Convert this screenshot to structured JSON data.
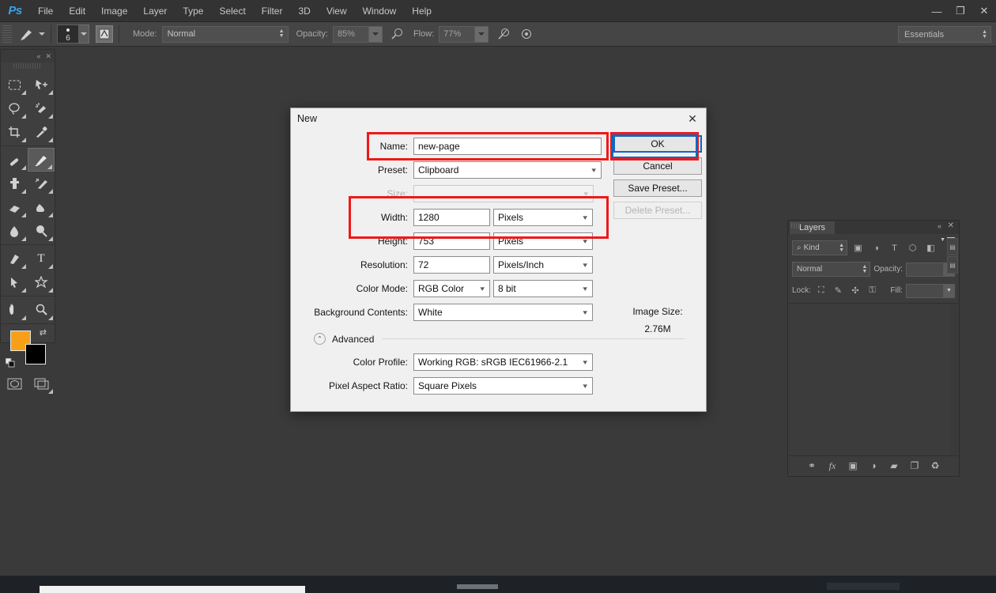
{
  "app": {
    "logo": "Ps",
    "menus": [
      "File",
      "Edit",
      "Image",
      "Layer",
      "Type",
      "Select",
      "Filter",
      "3D",
      "View",
      "Window",
      "Help"
    ],
    "window_controls": {
      "minimize": "—",
      "restore": "❐",
      "close": "✕"
    }
  },
  "options_bar": {
    "brush_size": "6",
    "mode_label": "Mode:",
    "mode_value": "Normal",
    "opacity_label": "Opacity:",
    "opacity_value": "85%",
    "flow_label": "Flow:",
    "flow_value": "77%",
    "workspace": "Essentials"
  },
  "toolbar": {
    "collapse_icon": "«",
    "close_icon": "✕",
    "tools": [
      {
        "name": "marquee-tool",
        "glyph": "⬚"
      },
      {
        "name": "move-tool",
        "glyph": "✣"
      },
      {
        "name": "lasso-tool",
        "glyph": "◯"
      },
      {
        "name": "quick-selection-tool",
        "glyph": "✦"
      },
      {
        "name": "crop-tool",
        "glyph": "⌗"
      },
      {
        "name": "eyedropper-tool",
        "glyph": "✒"
      },
      {
        "name": "healing-brush-tool",
        "glyph": "✐"
      },
      {
        "name": "brush-tool",
        "glyph": "✎"
      },
      {
        "name": "clone-stamp-tool",
        "glyph": "⚒"
      },
      {
        "name": "history-brush-tool",
        "glyph": "⚑"
      },
      {
        "name": "eraser-tool",
        "glyph": "▱"
      },
      {
        "name": "gradient-tool",
        "glyph": "◩"
      },
      {
        "name": "blur-tool",
        "glyph": "●"
      },
      {
        "name": "dodge-tool",
        "glyph": "⚲"
      },
      {
        "name": "pen-tool",
        "glyph": "✑"
      },
      {
        "name": "type-tool",
        "glyph": "T"
      },
      {
        "name": "path-selection-tool",
        "glyph": "➤"
      },
      {
        "name": "shape-tool",
        "glyph": "⭐"
      },
      {
        "name": "hand-tool",
        "glyph": "✋"
      },
      {
        "name": "zoom-tool",
        "glyph": "⌕"
      }
    ],
    "active_tool": "brush-tool",
    "foreground_color": "#F7A017",
    "background_color": "#000000",
    "swap_icon": "⇄",
    "quickmask_icon": "▣",
    "screenmode_icon": "◱"
  },
  "dialog": {
    "title": "New",
    "close_icon": "✕",
    "name_label": "Name:",
    "name_value": "new-page",
    "preset_label": "Preset:",
    "preset_value": "Clipboard",
    "size_label": "Size:",
    "size_value": "",
    "width_label": "Width:",
    "width_value": "1280",
    "width_unit": "Pixels",
    "height_label": "Height:",
    "height_value": "753",
    "height_unit": "Pixels",
    "resolution_label": "Resolution:",
    "resolution_value": "72",
    "resolution_unit": "Pixels/Inch",
    "color_mode_label": "Color Mode:",
    "color_mode_value": "RGB Color",
    "bit_depth_value": "8 bit",
    "background_label": "Background Contents:",
    "background_value": "White",
    "advanced_label": "Advanced",
    "advanced_toggle_icon": "⌃",
    "color_profile_label": "Color Profile:",
    "color_profile_value": "Working RGB:  sRGB IEC61966-2.1",
    "pixel_aspect_label": "Pixel Aspect Ratio:",
    "pixel_aspect_value": "Square Pixels",
    "buttons": {
      "ok": "OK",
      "cancel": "Cancel",
      "save_preset": "Save Preset...",
      "delete_preset": "Delete Preset..."
    },
    "image_size_label": "Image Size:",
    "image_size_value": "2.76M",
    "annotation_color": "#F01818",
    "focus_color": "#1565C0"
  },
  "layers_panel": {
    "tab_label": "Layers",
    "collapse_icon": "«",
    "close_icon": "✕",
    "menu_icon": "▾",
    "filter_label": "Kind",
    "filter_search_icon": "⌕",
    "filter_icons": [
      {
        "name": "filter-pixel-icon",
        "glyph": "▣"
      },
      {
        "name": "filter-adjustment-icon",
        "glyph": "◑"
      },
      {
        "name": "filter-type-icon",
        "glyph": "T"
      },
      {
        "name": "filter-shape-icon",
        "glyph": "⬡"
      },
      {
        "name": "filter-smart-object-icon",
        "glyph": "◧"
      }
    ],
    "filter_toggle_icon": "⬜",
    "blend_mode": "Normal",
    "opacity_label": "Opacity:",
    "opacity_value": "",
    "lock_label": "Lock:",
    "lock_icons": [
      {
        "name": "lock-transparent-pixels-icon",
        "glyph": "⛶"
      },
      {
        "name": "lock-image-pixels-icon",
        "glyph": "✎"
      },
      {
        "name": "lock-position-icon",
        "glyph": "✣"
      },
      {
        "name": "lock-all-icon",
        "glyph": "⚿"
      }
    ],
    "fill_label": "Fill:",
    "fill_value": "",
    "bottom_icons": [
      {
        "name": "link-layers-icon",
        "glyph": "⚭"
      },
      {
        "name": "layer-style-icon",
        "glyph": "fx"
      },
      {
        "name": "layer-mask-icon",
        "glyph": "▣"
      },
      {
        "name": "adjustment-layer-icon",
        "glyph": "◑"
      },
      {
        "name": "new-group-icon",
        "glyph": "▰"
      },
      {
        "name": "new-layer-icon",
        "glyph": "❐"
      },
      {
        "name": "delete-layer-icon",
        "glyph": "♻"
      }
    ],
    "side_icons": [
      {
        "name": "channels-tab-icon",
        "glyph": "▤"
      },
      {
        "name": "paths-tab-icon",
        "glyph": "▤"
      }
    ]
  }
}
